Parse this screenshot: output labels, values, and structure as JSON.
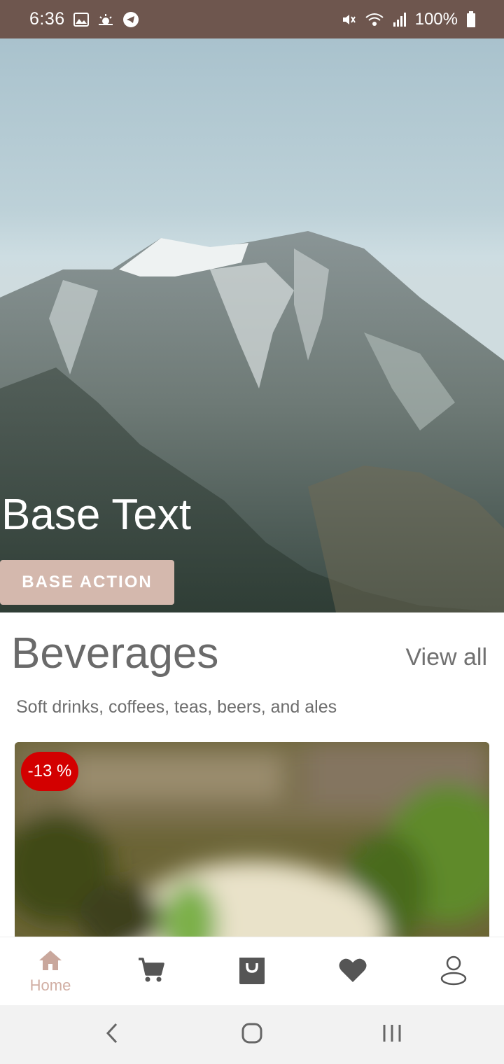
{
  "status_bar": {
    "time": "6:36",
    "battery": "100%",
    "background": "#6e564e",
    "icons_left": [
      "gallery-icon",
      "weather-icon",
      "telegram-icon"
    ],
    "icons_right": [
      "mute-icon",
      "wifi-icon",
      "signal-icon",
      "battery-icon"
    ]
  },
  "hero": {
    "title": "Base Text",
    "action_label": "BASE ACTION",
    "action_color": "#d4b8ad"
  },
  "section": {
    "title": "Beverages",
    "view_all": "View all",
    "subtitle": "Soft drinks, coffees, teas, beers, and ales"
  },
  "product": {
    "discount": "-13 %",
    "badge_color": "#d30000"
  },
  "bottom_nav": {
    "items": [
      {
        "label": "Home",
        "icon": "home-icon",
        "active": true
      },
      {
        "label": "",
        "icon": "cart-icon",
        "active": false
      },
      {
        "label": "",
        "icon": "shopping-bag-icon",
        "active": false
      },
      {
        "label": "",
        "icon": "heart-icon",
        "active": false
      },
      {
        "label": "",
        "icon": "profile-icon",
        "active": false
      }
    ],
    "active_color": "#d1aea3",
    "inactive_color": "#555555"
  },
  "system_nav": [
    "back-icon",
    "home-button-icon",
    "recents-icon"
  ]
}
